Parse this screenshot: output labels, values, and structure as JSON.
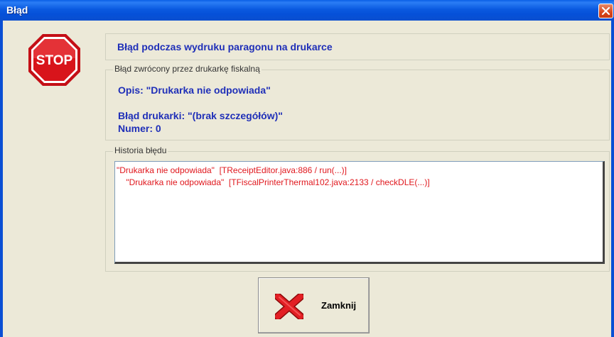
{
  "window": {
    "title": "Błąd",
    "close_icon": "close-icon"
  },
  "stop_sign": {
    "text": "STOP",
    "icon": "stop-sign-icon",
    "color": "#d8141b"
  },
  "message": "Błąd podczas wydruku paragonu na drukarce",
  "printer_error": {
    "legend": "Błąd zwrócony przez drukarkę fiskalną",
    "description": "Opis: \"Drukarka nie odpowiada\"",
    "printer_error": "Błąd drukarki: \"(brak szczegółów)\"",
    "number": "Numer: 0"
  },
  "history": {
    "legend": "Historia błędu",
    "lines": [
      "\"Drukarka nie odpowiada\"  [TReceiptEditor.java:886 / run(...)]",
      "    \"Drukarka nie odpowiada\"  [TFiscalPrinterThermal102.java:2133 / checkDLE(...)]"
    ]
  },
  "footer": {
    "close_label": "Zamknij",
    "close_icon": "red-x-icon"
  },
  "colors": {
    "accent_blue": "#1f2fb8",
    "error_red": "#e0171d",
    "titlebar": "#0a5ae0"
  }
}
